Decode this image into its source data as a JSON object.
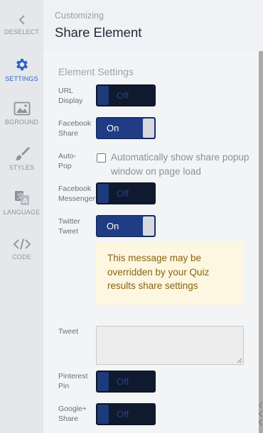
{
  "rail": {
    "deselect": {
      "label": "DESELECT",
      "icon": "chevron-left-icon"
    },
    "settings": {
      "label": "SETTINGS",
      "icon": "gear-icon",
      "active": true
    },
    "bground": {
      "label": "BGROUND",
      "icon": "image-icon"
    },
    "styles": {
      "label": "STYLES",
      "icon": "brush-icon"
    },
    "language": {
      "label": "LANGUAGE",
      "icon": "translate-icon"
    },
    "code": {
      "label": "CODE",
      "icon": "code-icon"
    }
  },
  "header": {
    "kicker": "Customizing",
    "title": "Share Element"
  },
  "panel": {
    "section_title": "Element Settings",
    "url_display": {
      "label": "URL Display",
      "state": "Off"
    },
    "facebook_share": {
      "label": "Facebook Share",
      "state": "On"
    },
    "auto_pop": {
      "label": "Auto-Pop",
      "checked": false,
      "text": "Automatically show share popup window on page load"
    },
    "facebook_messenger": {
      "label": "Facebook Messenger",
      "state": "Off"
    },
    "twitter_tweet": {
      "label": "Twitter Tweet",
      "state": "On"
    },
    "note": "This message may be overridden by your Quiz results share settings",
    "tweet": {
      "label": "Tweet",
      "value": "",
      "placeholder": ""
    },
    "pinterest_pin": {
      "label": "Pinterest Pin",
      "state": "Off"
    },
    "google_share": {
      "label": "Google+ Share",
      "state": "Off"
    }
  },
  "colors": {
    "accent": "#2d63c8",
    "toggle_on": "#1f3c84",
    "toggle_off": "#101a2e",
    "note_bg": "#fdf6e0",
    "note_text": "#8a6410"
  }
}
